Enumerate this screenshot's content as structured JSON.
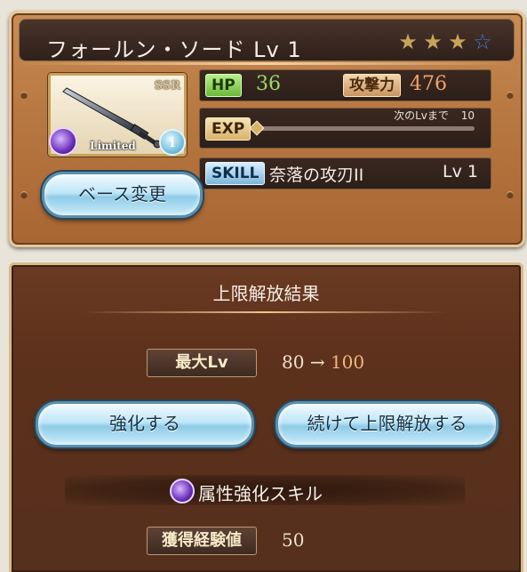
{
  "weapon": {
    "name": "フォールン・ソード Lv 1",
    "rarity": "SSR",
    "limited_label": "Limited",
    "element_icon": "dark-element-icon",
    "stars": {
      "filled": 3,
      "total": 4
    }
  },
  "stats": {
    "hp_label": "HP",
    "hp_value": "36",
    "atk_label": "攻撃力",
    "atk_value": "476",
    "exp_label": "EXP",
    "exp_next_label": "次のLvまで",
    "exp_next_value": "10",
    "exp_progress": 0.0,
    "skill_label": "SKILL",
    "skill_name": "奈落の攻刃II",
    "skill_level": "Lv 1"
  },
  "buttons": {
    "base_change": "ベース変更",
    "enhance": "強化する",
    "continue_uncap": "続けて上限解放する"
  },
  "result": {
    "title": "上限解放結果",
    "max_lv_label": "最大Lv",
    "max_lv_old": "80",
    "arrow": "→",
    "max_lv_new": "100",
    "skill_unlock": "属性強化スキル",
    "exp_gain_label": "獲得経験値",
    "exp_gain_value": "50"
  },
  "colors": {
    "card_bg": "#b97942",
    "panel_bg": "#5d311c",
    "star_filled": "#c8a45a",
    "star_empty": "#3a7bd5",
    "hp_value": "#9ad96b",
    "atk_value": "#f0a26a"
  }
}
